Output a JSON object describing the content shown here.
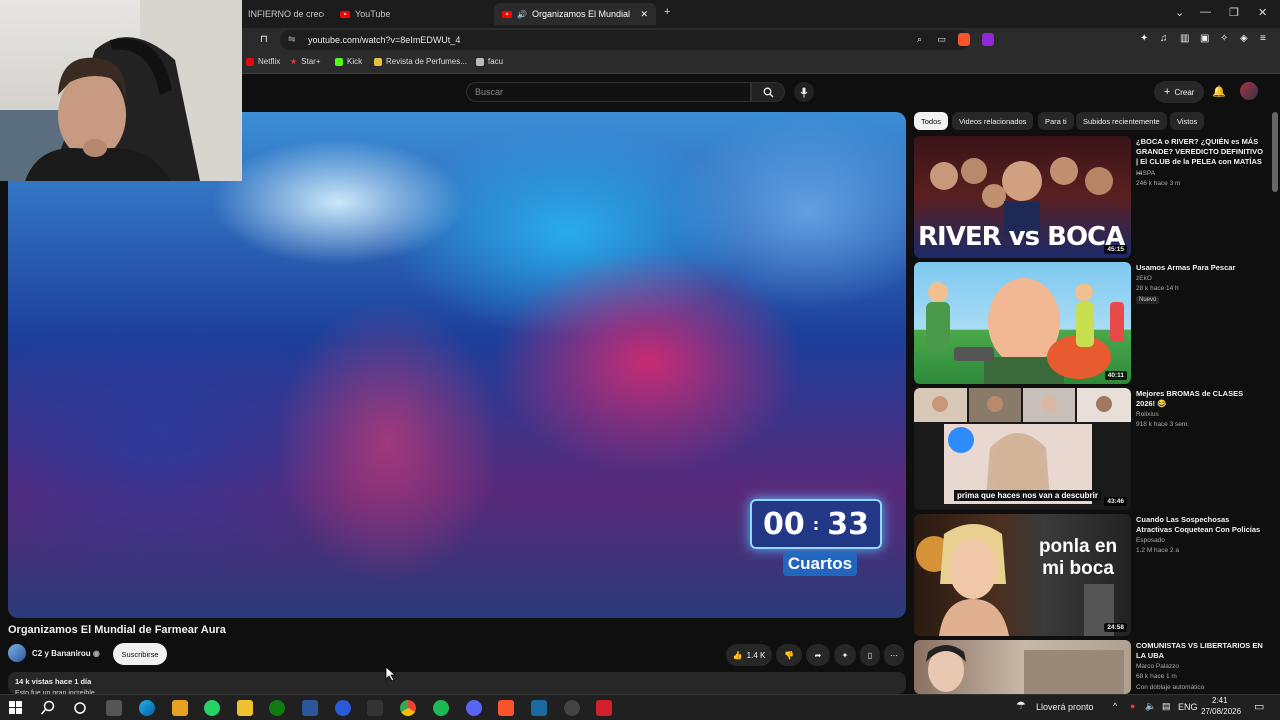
{
  "browser": {
    "tabs": [
      {
        "label": "INFIERNO de crecer e"
      },
      {
        "label": "YouTube"
      },
      {
        "label": "Organizamos El Mundial de F"
      }
    ],
    "url": "youtube.com/watch?v=8eImEDWUt_4",
    "bookmarks": [
      "Netflix",
      "Star+",
      "Kick",
      "Revista de Perfumes...",
      "facu"
    ]
  },
  "youtube": {
    "search_placeholder": "Buscar",
    "create_label": "Crear"
  },
  "video": {
    "timer_minutes": "00",
    "timer_seconds": "33",
    "timer_label": "Cuartos",
    "title": "Organizamos El Mundial de Farmear Aura",
    "channel": "C2 y Bananirou",
    "subscribe": "Suscribirse",
    "likes": "1.4 K",
    "views_line": "14 k vistas  hace 1 día",
    "desc_line": "Esto fue un gran increíble"
  },
  "sidebar": {
    "chips": [
      "Todos",
      "Videos relacionados",
      "Para ti",
      "Subidos recientemente",
      "Vistos"
    ],
    "videos": [
      {
        "title": "¿BOCA o RIVER? ¿QUIÉN es MÁS GRANDE? VEREDICTO DEFINITIVO | El CLUB de la PELEA con MATÍAS ...",
        "channel": "HISPA",
        "meta": "246 k  hace 3 m",
        "duration": "45:15",
        "thumb_text": "RIVER vs BOCA",
        "badge": ""
      },
      {
        "title": "Usamos Armas Para Pescar",
        "channel": "zEkO",
        "meta": "28 k  hace 14 h",
        "duration": "40:11",
        "thumb_text": "",
        "badge": "Nuevo"
      },
      {
        "title": "Mejores BROMAS de CLASES 2026! 😂",
        "channel": "Rolixius",
        "meta": "918 k  hace 3 sem.",
        "duration": "43:46",
        "thumb_text": "prima que haces nos van a descubrir",
        "badge": ""
      },
      {
        "title": "Cuando Las Sospechosas Atractivas Coquetean Con Policías",
        "channel": "Esposado",
        "meta": "1.2 M  hace 2 a",
        "duration": "24:58",
        "thumb_text": "ponla en mi boca",
        "badge": ""
      },
      {
        "title": "COMUNISTAS VS LIBERTARIOS EN LA UBA",
        "channel": "Marco Palazzo",
        "meta": "68 k  hace 1 m",
        "duration": "",
        "thumb_text": "",
        "badge": "Con doblaje automático"
      }
    ]
  },
  "taskbar": {
    "weather": "Lloverá pronto",
    "lang": "ENG",
    "time": "2:41",
    "date": "27/08/2026"
  }
}
